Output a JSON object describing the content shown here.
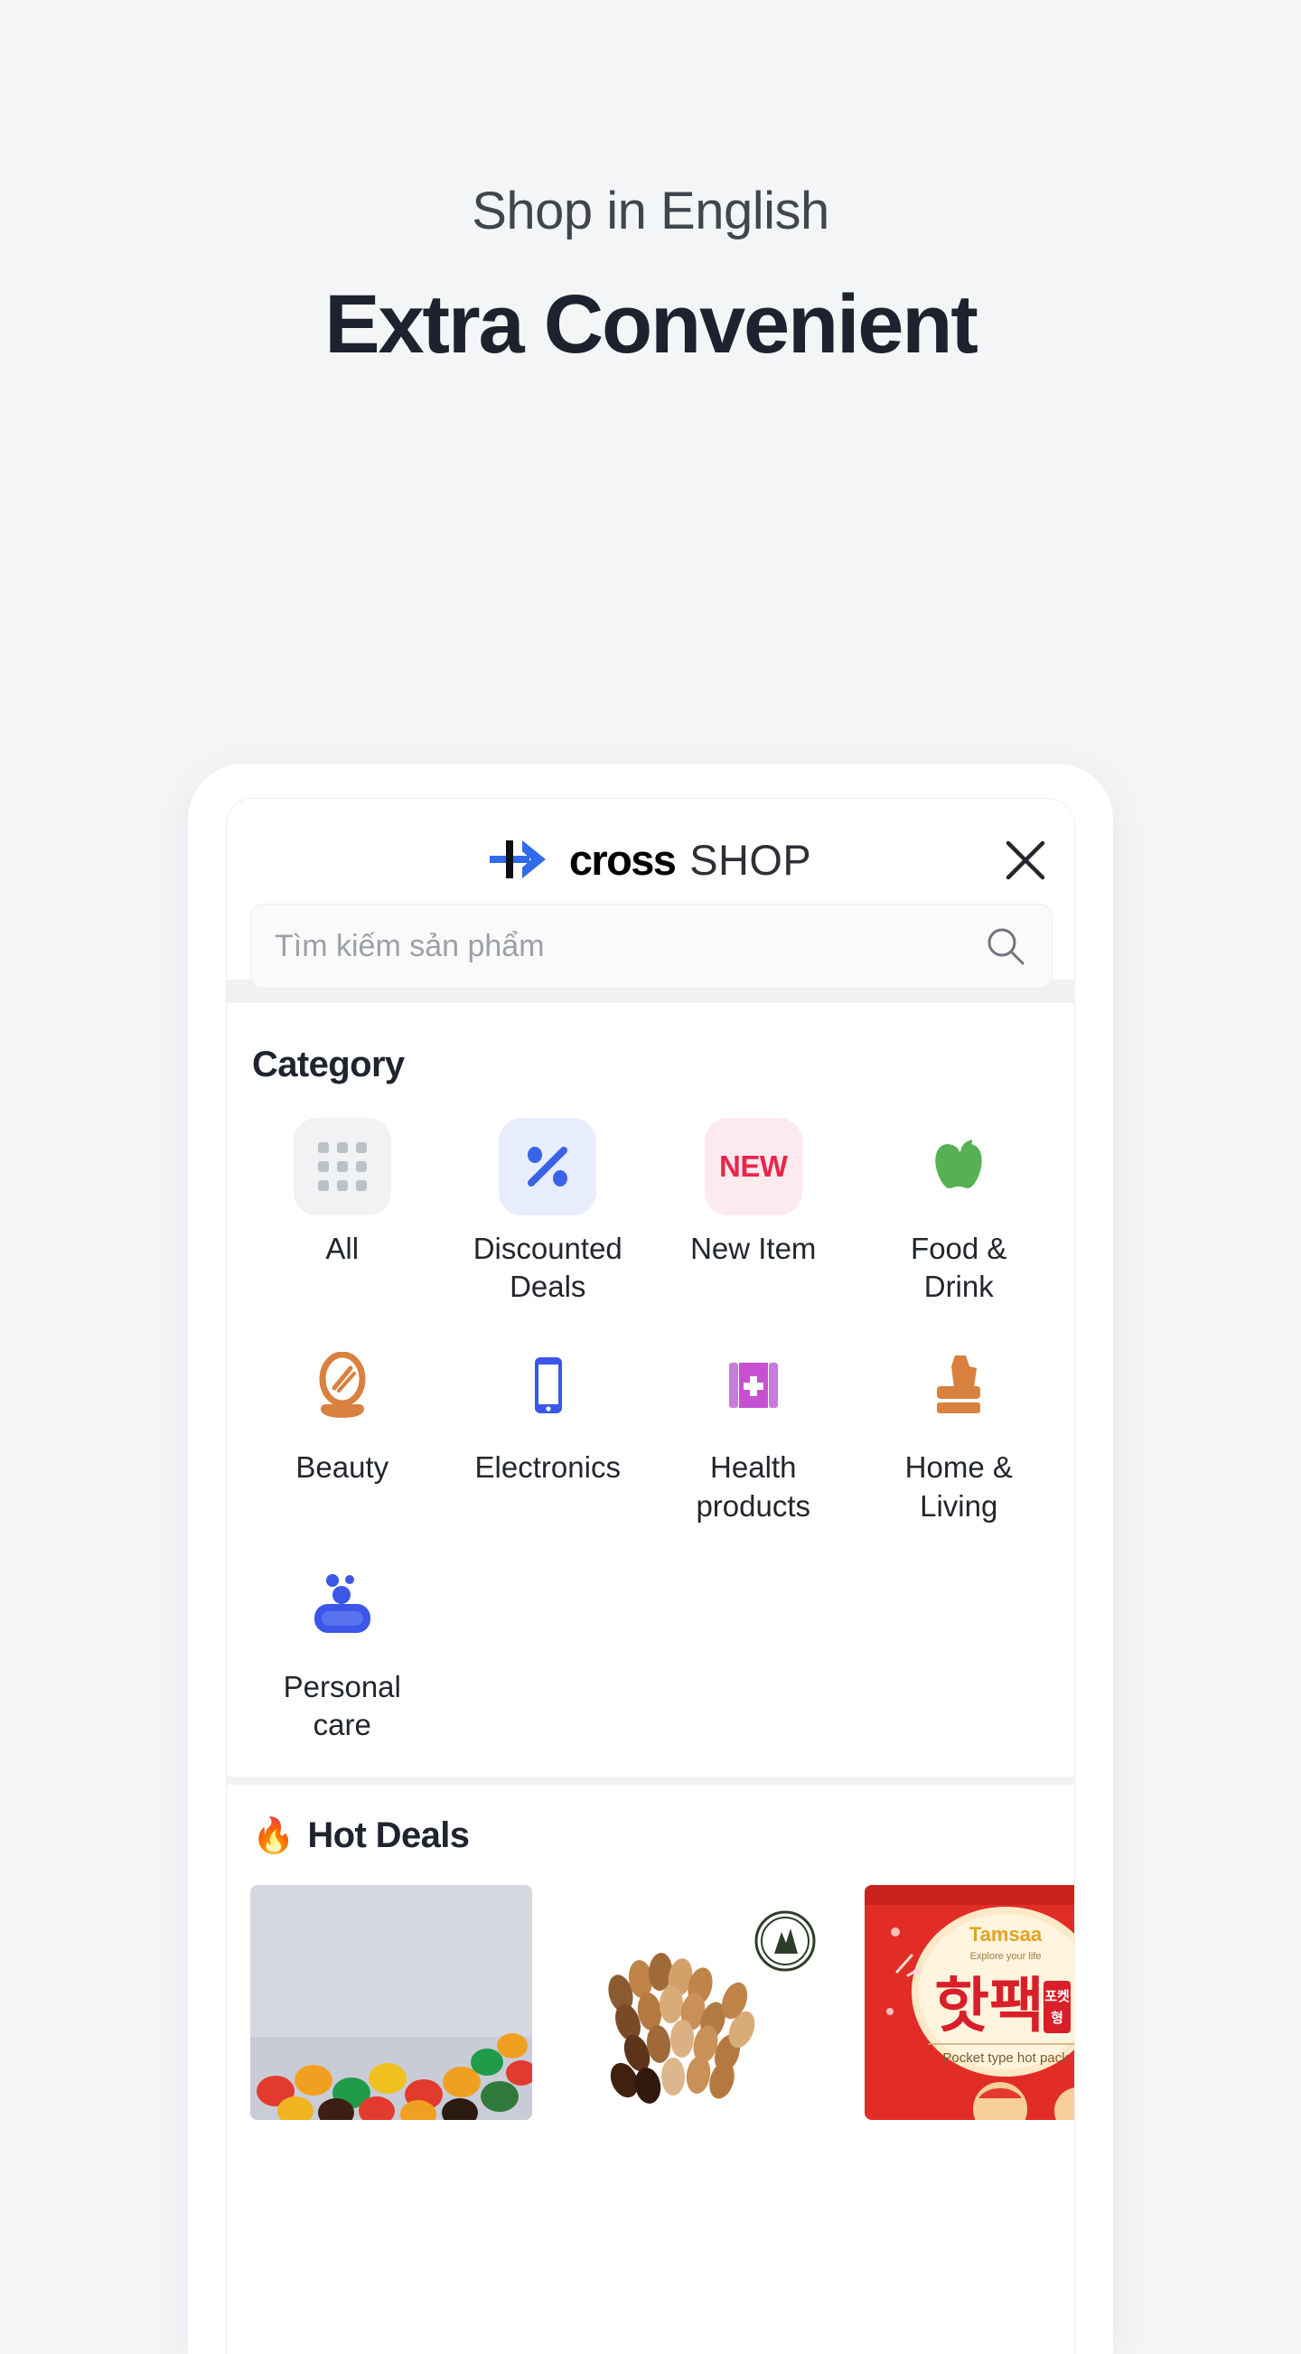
{
  "hero": {
    "subtitle": "Shop in English",
    "title": "Extra Convenient"
  },
  "app": {
    "brand": {
      "mark_icon": "cross-arrow-logo-icon",
      "name_bold": "cross",
      "name_light": "SHOP"
    },
    "close_icon": "close-icon",
    "search": {
      "placeholder": "Tìm kiếm sản phẩm",
      "value": "",
      "icon": "search-icon"
    },
    "category": {
      "title": "Category",
      "items": [
        {
          "label": "All",
          "icon": "grid-dots-icon",
          "tile_bg": "#f1f2f4",
          "fg": "#bdc1c7"
        },
        {
          "label": "Discounted Deals",
          "icon": "percent-icon",
          "tile_bg": "#e8edfd",
          "fg": "#3b63e8"
        },
        {
          "label": "New Item",
          "icon": "new-badge-icon",
          "tile_bg": "#fdeaee",
          "fg": "#e8274b",
          "badge_text": "NEW"
        },
        {
          "label": "Food & Drink",
          "icon": "apple-icon",
          "tile_bg": "transparent",
          "fg": "#56b153"
        },
        {
          "label": "Beauty",
          "icon": "hand-mirror-icon",
          "tile_bg": "transparent",
          "fg": "#d9813f"
        },
        {
          "label": "Electronics",
          "icon": "smartphone-icon",
          "tile_bg": "transparent",
          "fg": "#3b56e8"
        },
        {
          "label": "Health products",
          "icon": "medical-book-icon",
          "tile_bg": "transparent",
          "fg": "#c650cf"
        },
        {
          "label": "Home & Living",
          "icon": "tissue-box-icon",
          "tile_bg": "transparent",
          "fg": "#d9813f"
        },
        {
          "label": "Personal care",
          "icon": "soap-bar-icon",
          "tile_bg": "transparent",
          "fg": "#3b56e8"
        }
      ]
    },
    "hot_deals": {
      "emoji": "🔥",
      "title": "Hot Deals",
      "items": [
        {
          "name": "colorful-candy-product",
          "alt": "Assorted colorful candy beans"
        },
        {
          "name": "mixed-nuts-product",
          "alt": "Mixed almonds and nuts with Mountain & Field seal",
          "seal_text": "MOUNTAIN & FIELD"
        },
        {
          "name": "hot-pack-product",
          "alt": "Tamsaa pocket type hot pack",
          "brand": "Tamsaa",
          "tagline": "Explore your life",
          "korean": "핫팩",
          "korean_side": "포켓형",
          "caption": "Pocket type hot pack"
        }
      ]
    }
  },
  "colors": {
    "page_bg": "#f4f5f7",
    "hero_title": "#1e222e",
    "hero_sub": "#41464d",
    "brand_blue": "#2f6bea",
    "divider": "#f0f1f3"
  }
}
